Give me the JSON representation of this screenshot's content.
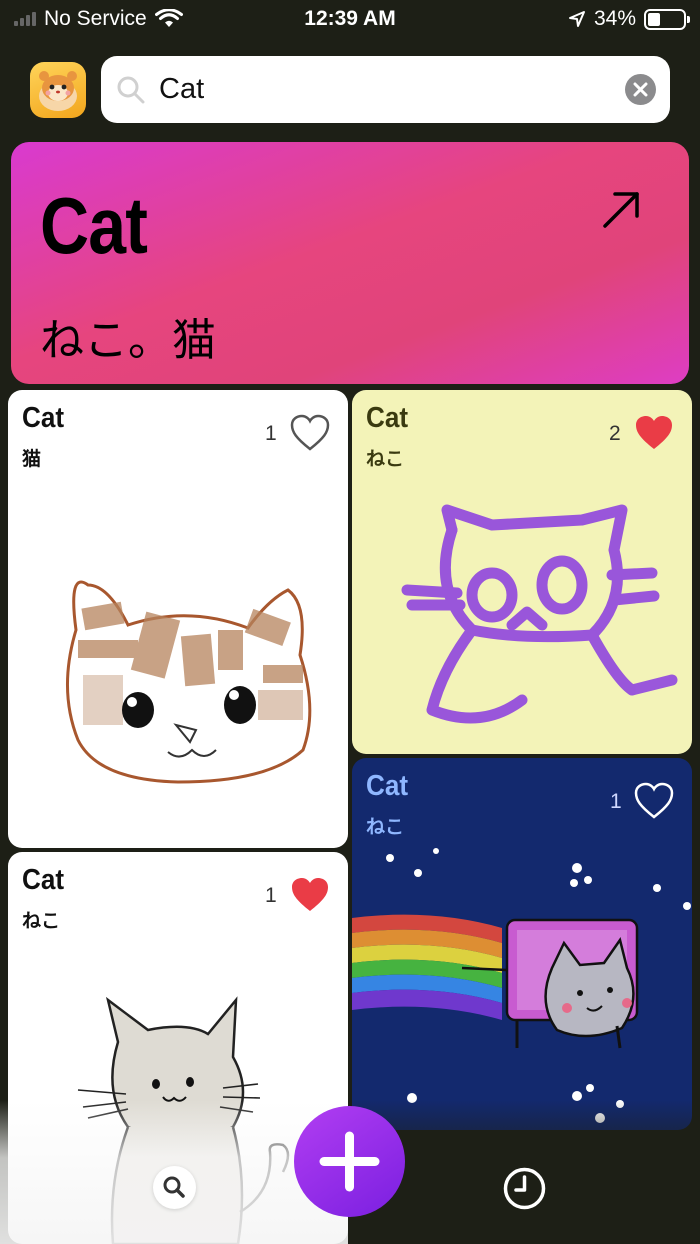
{
  "status_bar": {
    "carrier": "No Service",
    "time": "12:39 AM",
    "battery": "34%",
    "battery_level": 0.34
  },
  "search": {
    "value": "Cat",
    "placeholder": "Search"
  },
  "hero": {
    "title": "Cat",
    "subtitle": "ねこ。猫"
  },
  "cards": [
    {
      "title": "Cat",
      "subtitle": "猫",
      "likes": "1",
      "liked": false,
      "drawing": "tabby-cat-face",
      "background": "#ffffff",
      "text_color": "#111111"
    },
    {
      "title": "Cat",
      "subtitle": "ねこ",
      "likes": "2",
      "liked": true,
      "drawing": "purple-cat-outline",
      "background": "#f3f3b8",
      "text_color": "#3a3a10"
    },
    {
      "title": "Cat",
      "subtitle": "ねこ",
      "likes": "1",
      "liked": false,
      "drawing": "nyan-cat-rainbow",
      "background": "#13296e",
      "text_color": "#8fb7ff"
    },
    {
      "title": "Cat",
      "subtitle": "ねこ",
      "likes": "1",
      "liked": true,
      "drawing": "gray-cat-sitting",
      "background": "#ffffff",
      "text_color": "#111111"
    }
  ],
  "colors": {
    "background": "#1d1f16",
    "heart_red": "#ea3c46",
    "fab_purple": "#9b2ff0"
  },
  "tab_bar": {
    "left_icon": "search-icon",
    "center_icon": "plus-icon",
    "right_icon": "clock-icon"
  }
}
